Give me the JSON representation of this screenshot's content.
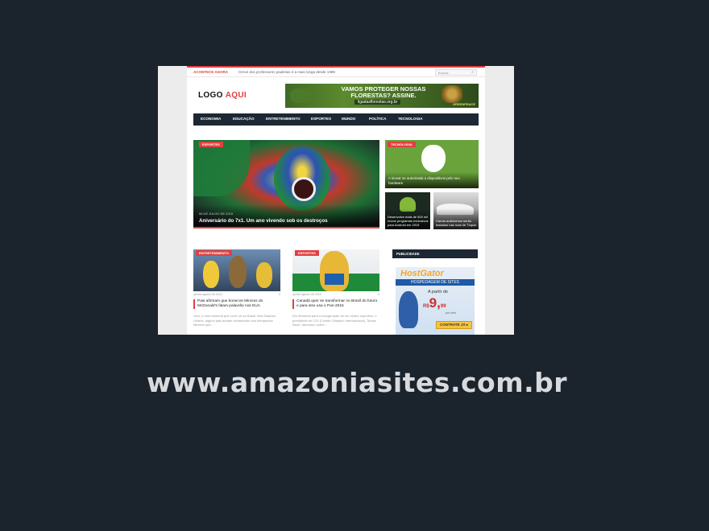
{
  "topbar": {
    "label": "ACONTECE AGORA",
    "ticker": "Greve dos professores paulistas é a mais longa desde 1989",
    "search_placeholder": "Buscar..."
  },
  "header": {
    "logo_main": "LOGO",
    "logo_accent": "AQUI",
    "banner_title": "VAMOS PROTEGER NOSSAS FLORESTAS? ASSINE.",
    "banner_url": "ligadasflorestas.org.br",
    "banner_brand": "GREENPEACE"
  },
  "nav": [
    "ECONOMIA",
    "EDUCAÇÃO",
    "ENTRETENIMENTO",
    "ESPORTES",
    "MUNDO",
    "POLÍTICA",
    "TECNOLOGIA"
  ],
  "featured": {
    "tag": "ESPORTES",
    "date": "08 DE JULHO DE 2015",
    "title": "Aniversário do 7x1. Um ano vivendo sob os destroços"
  },
  "side_top": {
    "tag": "TECNOLOGIA",
    "title": "A inovar se autorizada a dispositivos pelo seu hardware"
  },
  "side_small": [
    {
      "title": "Desenvolve mais de 500 mil novos programas exclusivos para Android em 2015"
    },
    {
      "title": "Carros autônomos serão testados nas ruas de Tóquio"
    }
  ],
  "cards": [
    {
      "tag": "ENTRETENIMENTO",
      "date": "quinta agosto 06 2015",
      "count": "0",
      "title": "Pais afirmam que bonecos Minions do McDonald's falam palavrão nos EUA",
      "excerpt": "Vem, é uma resenha que você vai só Brasil. Nos Estados Unidos, alguns pais andam reclamando dos brinquedos Minions que..."
    },
    {
      "tag": "ESPORTES",
      "date": "quinta agosto 06 2015",
      "count": "0",
      "title": "Canadá quer se transformar no Brasil do futuro e para isso usa o Pan-2015",
      "excerpt": "Em Montreal para a inauguração de um centro esportivo, o presidente do COI (Comitê Olímpico Internacional), Tomas Bach, discursou sobre..."
    }
  ],
  "sidebar": {
    "heading": "PUBLICIDADE",
    "ad_brand": "HostGator",
    "ad_sub": "HOSPEDAGEM DE SITES",
    "ad_from": "A partir de",
    "ad_currency": "R$",
    "ad_price": "9,",
    "ad_cents": "99",
    "ad_per": "por mês",
    "ad_cta": "CONTRATE JÁ ▸"
  },
  "footer_url": "www.amazoniasites.com.br",
  "colors": {
    "background": "#1b232d",
    "accent": "#e0403f",
    "nav": "#1c2833"
  }
}
